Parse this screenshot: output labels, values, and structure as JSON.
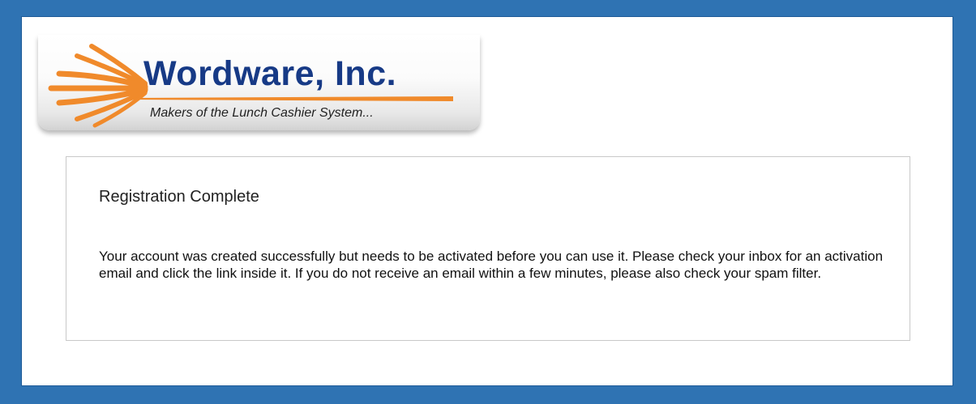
{
  "colors": {
    "frame_blue": "#2f73b3",
    "logo_navy": "#173a86",
    "logo_orange": "#f08a2b"
  },
  "logo": {
    "company_name": "Wordware, Inc.",
    "tagline": "Makers of the Lunch Cashier System...",
    "icon": "sunburst-rays-icon"
  },
  "message": {
    "title": "Registration Complete",
    "body": "Your account was created successfully but needs to be activated before you can use it. Please check your inbox for an activation email and click the link inside it. If you do not receive an email within a few minutes, please also check your spam filter."
  }
}
